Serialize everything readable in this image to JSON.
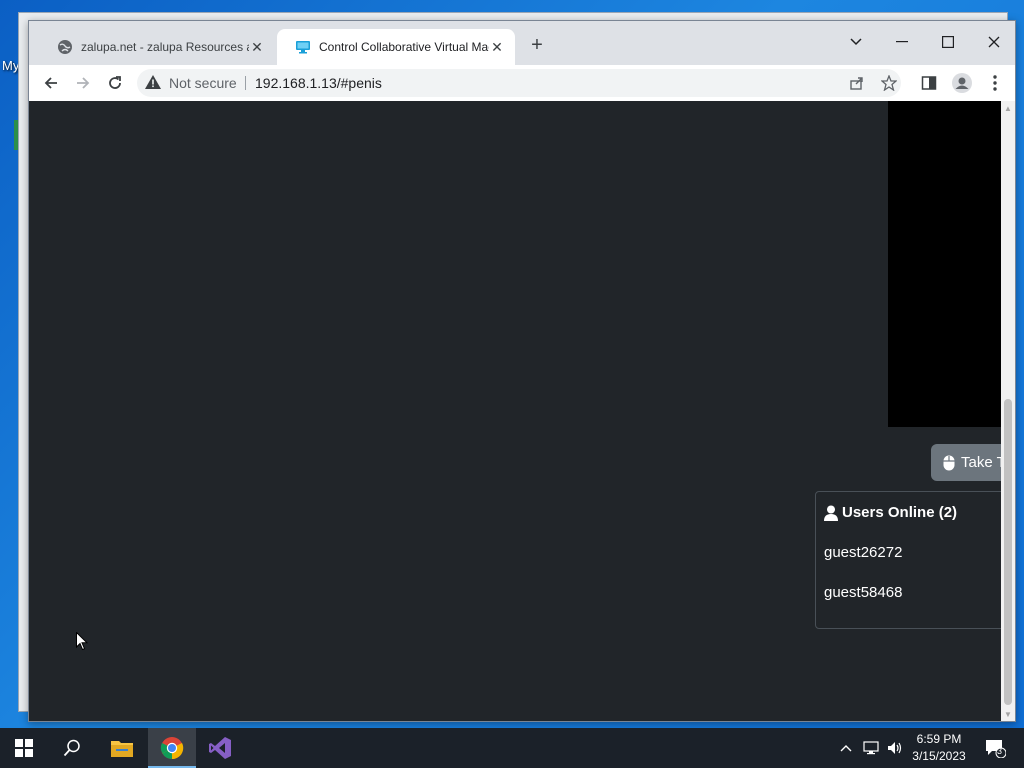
{
  "desktop": {
    "icon_label": "My"
  },
  "browser": {
    "tabs": [
      {
        "title": "zalupa.net - zalupa Resources and",
        "favicon": "globe-icon",
        "active": false
      },
      {
        "title": "Control Collaborative Virtual Mac",
        "favicon": "monitor-icon",
        "active": true
      }
    ],
    "security_label": "Not secure",
    "url": "192.168.1.13/#penis"
  },
  "page": {
    "take_turn_label": "Take T",
    "users_online_label": "Users Online (2)",
    "users": [
      "guest26272",
      "guest58468"
    ]
  },
  "taskbar": {
    "apps": [
      "start-icon",
      "search-icon",
      "file-explorer-icon",
      "chrome-icon",
      "visual-studio-icon"
    ],
    "clock_time": "6:59 PM",
    "clock_date": "3/15/2023",
    "notification_count": "3"
  },
  "colors": {
    "page_bg": "#212529",
    "button_secondary": "#6c757d",
    "taskbar": "#1b2129",
    "desktop": "#0b5fc4"
  }
}
